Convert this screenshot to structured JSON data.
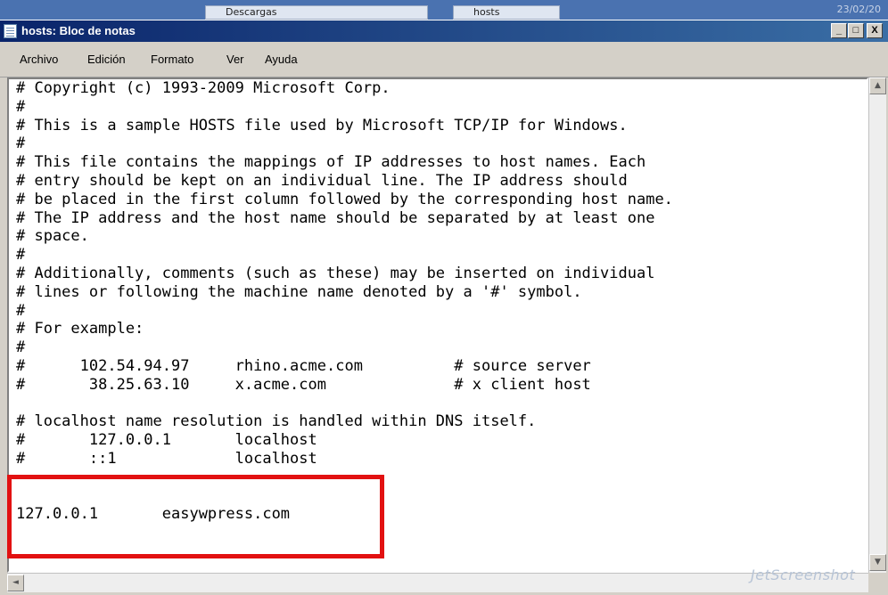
{
  "background": {
    "tab1_label": "Descargas",
    "tab2_label": "hosts",
    "date_text": "23/02/20"
  },
  "window": {
    "title": "hosts: Bloc de notas",
    "minimize_glyph": "_",
    "maximize_glyph": "□",
    "close_glyph": "X"
  },
  "menu": {
    "items": [
      "Archivo",
      "Edición",
      "Formato",
      "Ver",
      "Ayuda"
    ]
  },
  "document": {
    "lines": [
      "# Copyright (c) 1993-2009 Microsoft Corp.",
      "#",
      "# This is a sample HOSTS file used by Microsoft TCP/IP for Windows.",
      "#",
      "# This file contains the mappings of IP addresses to host names. Each",
      "# entry should be kept on an individual line. The IP address should",
      "# be placed in the first column followed by the corresponding host name.",
      "# The IP address and the host name should be separated by at least one",
      "# space.",
      "#",
      "# Additionally, comments (such as these) may be inserted on individual",
      "# lines or following the machine name denoted by a '#' symbol.",
      "#",
      "# For example:",
      "#",
      "#      102.54.94.97     rhino.acme.com          # source server",
      "#       38.25.63.10     x.acme.com              # x client host",
      "",
      "# localhost name resolution is handled within DNS itself.",
      "#       127.0.0.1       localhost",
      "#       ::1             localhost",
      "",
      "",
      "127.0.0.1       easywpress.com"
    ]
  },
  "scrollbar": {
    "up_glyph": "▲",
    "down_glyph": "▼",
    "left_glyph": "◄"
  },
  "watermark": {
    "text": "JetScreenshot"
  },
  "colors": {
    "highlight": "#e21111",
    "titlebar_start": "#0a246a",
    "titlebar_end": "#3a6ea5"
  }
}
